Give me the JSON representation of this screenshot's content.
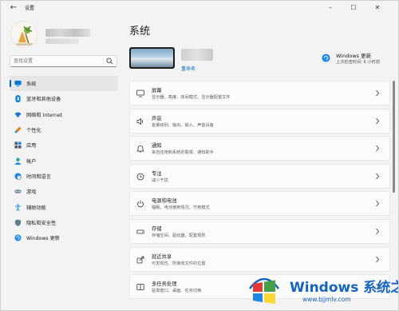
{
  "window": {
    "app_title": "设置",
    "minimize_symbol": "–",
    "maximize_symbol": "☐",
    "close_symbol": "✕",
    "back_symbol": "←"
  },
  "sidebar": {
    "search_placeholder": "查找设置",
    "items": [
      {
        "label": "系统",
        "icon": "monitor-icon",
        "active": true
      },
      {
        "label": "蓝牙和其他设备",
        "icon": "bluetooth-icon"
      },
      {
        "label": "网络和 Internet",
        "icon": "wifi-icon"
      },
      {
        "label": "个性化",
        "icon": "brush-icon"
      },
      {
        "label": "应用",
        "icon": "apps-icon"
      },
      {
        "label": "帐户",
        "icon": "account-icon"
      },
      {
        "label": "时间和语言",
        "icon": "globe-clock-icon"
      },
      {
        "label": "游戏",
        "icon": "gamepad-icon"
      },
      {
        "label": "辅助功能",
        "icon": "accessibility-icon"
      },
      {
        "label": "隐私和安全性",
        "icon": "shield-icon"
      },
      {
        "label": "Windows 更新",
        "icon": "update-icon"
      }
    ]
  },
  "main": {
    "title": "系统",
    "rename_label": "重命名",
    "windows_update": {
      "title": "Windows 更新",
      "subtitle": "上次检查时间: 6 小时前"
    },
    "cards": [
      {
        "title": "屏幕",
        "subtitle": "显示器、亮度、夜间模式、显示器配置文件",
        "icon": "display-icon"
      },
      {
        "title": "声音",
        "subtitle": "音量级别、输出、输入、声音设备",
        "icon": "speaker-icon"
      },
      {
        "title": "通知",
        "subtitle": "来自应用和系统的警报、通知助手",
        "icon": "bell-icon"
      },
      {
        "title": "专注",
        "subtitle": "减少干扰",
        "icon": "focus-icon"
      },
      {
        "title": "电源和电池",
        "subtitle": "睡眠、电池使用情况、节电模式",
        "icon": "power-icon"
      },
      {
        "title": "存储",
        "subtitle": "存储空间、驱动器、配置规则",
        "icon": "storage-icon"
      },
      {
        "title": "就近共享",
        "subtitle": "可发现性、所接收文件的位置",
        "icon": "share-icon"
      },
      {
        "title": "多任务处理",
        "subtitle": "贴靠窗口、桌面、任务切换",
        "icon": "multitask-icon"
      }
    ]
  },
  "watermark": {
    "brand": "Windows 系统之家",
    "url": "www.bjjmlv.com"
  },
  "colors": {
    "accent": "#0067c0",
    "window_bg": "#f3f3f3",
    "card_bg": "#fbfbfb"
  }
}
